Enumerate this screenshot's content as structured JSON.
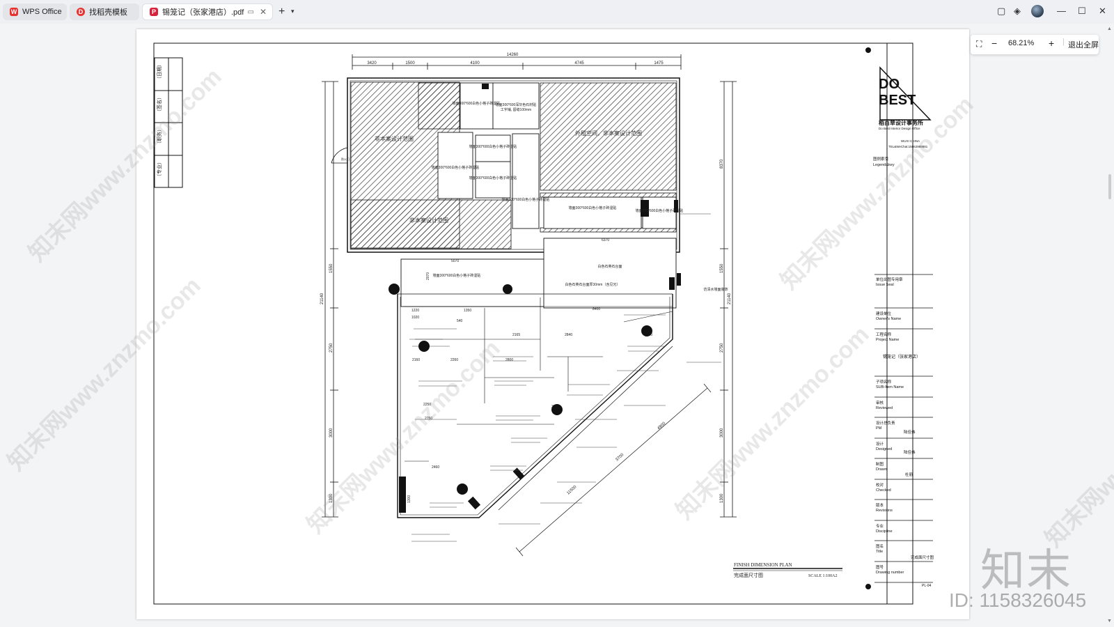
{
  "tabs": [
    {
      "label": "WPS Office"
    },
    {
      "label": "找稻壳模板"
    },
    {
      "label": "锡笼记（张家港店）.pdf"
    }
  ],
  "zoom": {
    "value": "68.21%",
    "exit_label": "退出全屏"
  },
  "drawing": {
    "title_en": "FINISH DIMENSION PLAN",
    "title_cn": "完成面尺寸图",
    "scale": "SCALE 1:100A2",
    "overall_dim": "14260",
    "top_dims": [
      "3420",
      "1500",
      "4100",
      "4745",
      "1475"
    ],
    "left_dims": [
      "1550",
      "2750",
      "3000",
      "1300"
    ],
    "left_total": "21140",
    "right_dims": [
      "8370",
      "1550",
      "2750",
      "3000",
      "1300"
    ],
    "right_total": "21140",
    "inner_dims": [
      "5070",
      "2070",
      "6370",
      "8400",
      "2260",
      "2165",
      "2840",
      "2800",
      "2160",
      "1380",
      "2750",
      "2460",
      "1300",
      "1350",
      "3070",
      "4900",
      "11500",
      "3700",
      "2250",
      "540",
      "1020",
      "1220"
    ],
    "area_labels": [
      "非本案设计范围",
      "外租空间，非本案设计范围",
      "非本案设计范围"
    ],
    "room_notes": [
      "墙面300*600白色小格子砖湿贴",
      "墙面300*600深灰色石材贴",
      "工字铺, 留缝100mm",
      "墙面300*600白色小格子砖湿贴",
      "墙面300*600白色小格子砖湿贴",
      "墙面300*600白色小格子砖湿贴",
      "墙面300*600白色小格子砖湿贴",
      "墙面300*600白色小格子砖湿贴",
      "墙面300*600白色小格子砖湿贴",
      "墙面300*600白色小格子砖湿贴",
      "白色石英石台面",
      "白色石英石台面厚30mm（含见光）",
      "仿清水墙面装饰"
    ],
    "left_titles": [
      "（日期）",
      "（签名）",
      "（职务）",
      "（专业）"
    ],
    "door_label": "防火门",
    "sheet_no": "PL-04"
  },
  "titleblock": {
    "company_cn": "稻百草设计事务所",
    "company_en": "Do Best Interior Design Office",
    "city": "WUXI CHINA",
    "contact": "TEL&WeChat:15862988881",
    "legend": [
      "图例索引",
      "Legend&key"
    ],
    "rows": [
      {
        "cn": "单位出图专用章",
        "en": "Issue Seal",
        "value": ""
      },
      {
        "cn": "建设单位",
        "en": "Owner's Name",
        "value": ""
      },
      {
        "cn": "工程名称",
        "en": "Project Name",
        "value": "锡笼记（张家港店）"
      },
      {
        "cn": "子项名称",
        "en": "SUB-Item Name",
        "value": ""
      },
      {
        "cn": "审核",
        "en": "Reviewed",
        "value": ""
      },
      {
        "cn": "设计总负责",
        "en": "PM",
        "value": "陆佳伟"
      },
      {
        "cn": "设计",
        "en": "Designed",
        "value": "陆佳伟"
      },
      {
        "cn": "制图",
        "en": "Drawn",
        "value": "杜丽"
      },
      {
        "cn": "校对",
        "en": "Checked",
        "value": ""
      },
      {
        "cn": "版本",
        "en": "Revisions",
        "value": ""
      },
      {
        "cn": "专业",
        "en": "Discipline",
        "value": ""
      },
      {
        "cn": "图名",
        "en": "Title",
        "value": "完成面尺寸图"
      },
      {
        "cn": "图号",
        "en": "Drawing number",
        "value": ""
      }
    ]
  },
  "watermarks": {
    "text": "知末网www.znzmo.com",
    "brand": "知末",
    "id": "ID: 1158326045"
  },
  "colors": {
    "accent": "#c4122f",
    "line": "#1a1a1a"
  }
}
